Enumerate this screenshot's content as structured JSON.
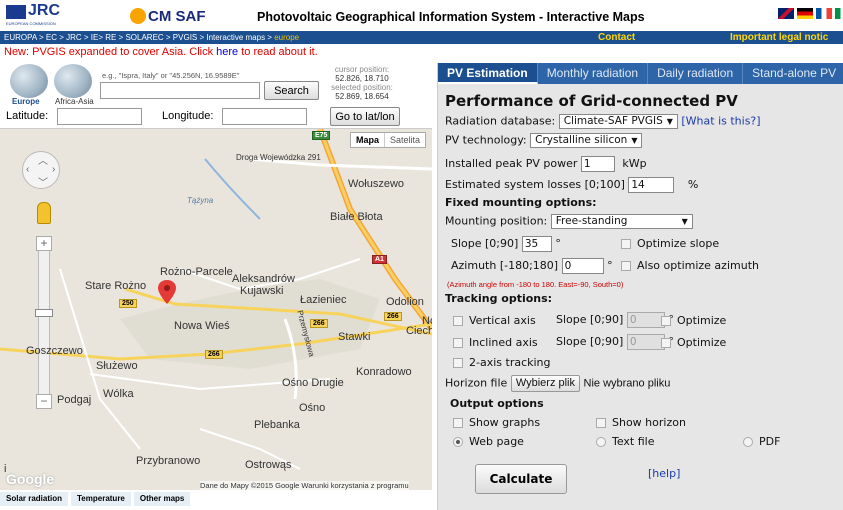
{
  "header": {
    "jrc_logo_text": "JRC",
    "jrc_logo_sub": "EUROPEAN COMMISSION",
    "cmsaf_logo_text": "CM SAF",
    "title": "Photovoltaic Geographical Information System - Interactive Maps",
    "flags": [
      "uk-flag-icon",
      "de-flag-icon",
      "fr-flag-icon",
      "it-flag-icon",
      "es-flag-icon"
    ]
  },
  "breadcrumb": {
    "items": [
      "EUROPA",
      "EC",
      "JRC",
      "IE",
      "RE",
      "SOLAREC",
      "PVGIS",
      "Interactive maps"
    ],
    "text": "EUROPA > EC > JRC > IE> RE > SOLAREC > PVGIS > Interactive maps > ",
    "current": "europe",
    "contact": "Contact",
    "legal": "Important legal notic"
  },
  "notice": {
    "before": "New: PVGIS expanded to cover Asia. Click ",
    "link": "here",
    "after": " to read about it."
  },
  "search": {
    "globe_europe": "Europe",
    "globe_asia": "Africa-Asia",
    "hint": "e.g., \"Ispra, Italy\" or \"45.256N, 16.9589E\"",
    "button": "Search",
    "cursor_label": "cursor position:",
    "cursor_value": "52.826, 18.710",
    "selected_label": "selected position:",
    "selected_value": "52.869, 18.654",
    "latitude_label": "Latitude:",
    "longitude_label": "Longitude:",
    "goto_button": "Go to lat/lon"
  },
  "map": {
    "type_map": "Mapa",
    "type_satellite": "Satelita",
    "labels": {
      "droga": "Droga Wojewódzka 291",
      "wol": "Wołuszewo",
      "tazyna": "Tążyna",
      "biale": "Białe Błota",
      "rozno": "Rożno-Parcele",
      "stare": "Stare Rożno",
      "aleks1": "Aleksandrów",
      "aleks2": "Kujawski",
      "lazieniec": "Łazieniec",
      "odolion": "Odolion",
      "ciechocinek": "Ciechi",
      "nowa": "Nowa Wieś",
      "stawki": "Stawki",
      "goszczewo": "Goszczewo",
      "sluzewo": "Służewo",
      "konradowo": "Konradowo",
      "osno_d": "Ośno Drugie",
      "wolka": "Wólka",
      "podgaj": "Podgaj",
      "osno": "Ośno",
      "plebanka": "Plebanka",
      "przybranowo": "Przybranowo",
      "ostrowas": "Ostrowąs",
      "przemyslowa": "Przemysłowa",
      "nc": "Nc",
      "c_left": "i"
    },
    "road_tags": {
      "e75": "E75",
      "a1": "A1",
      "r250": "250",
      "r266a": "266",
      "r266b": "266",
      "r266c": "266"
    },
    "google": "Google",
    "credit": "Dane do Mapy ©2015 Google   Warunki korzystania z programu"
  },
  "bottom_tabs": [
    "Solar radiation",
    "Temperature",
    "Other maps"
  ],
  "panel": {
    "tabs": [
      "PV Estimation",
      "Monthly radiation",
      "Daily radiation",
      "Stand-alone PV"
    ],
    "title": "Performance of Grid-connected PV",
    "radiation_db_label": "Radiation database:",
    "radiation_db_value": "Climate-SAF PVGIS",
    "what_is_this": "[What is this?]",
    "pv_tech_label": "PV technology:",
    "pv_tech_value": "Crystalline silicon",
    "peak_power_label": "Installed peak PV power",
    "peak_power_value": "1",
    "peak_power_unit": "kWp",
    "losses_label": "Estimated system losses [0;100]",
    "losses_value": "14",
    "losses_unit": "%",
    "fixed_header": "Fixed mounting options:",
    "mounting_label": "Mounting position:",
    "mounting_value": "Free-standing",
    "slope_label": "Slope [0;90]",
    "slope_value": "35",
    "deg": "°",
    "optimize_slope": "Optimize slope",
    "azimuth_label": "Azimuth [-180;180]",
    "azimuth_value": "0",
    "also_optimize_azimuth": "Also optimize azimuth",
    "azimuth_note": "(Azimuth angle from -180 to 180. East=-90, South=0)",
    "tracking_header": "Tracking options:",
    "vertical_axis": "Vertical axis",
    "inclined_axis": "Inclined axis",
    "two_axis": "2-axis tracking",
    "track_slope_label": "Slope [0;90]",
    "track_slope_value": "0",
    "optimize": "Optimize",
    "horizon_label": "Horizon file",
    "horizon_button": "Wybierz plik",
    "horizon_status": "Nie wybrano pliku",
    "output_header": "Output options",
    "show_graphs": "Show graphs",
    "show_horizon": "Show horizon",
    "web_page": "Web page",
    "text_file": "Text file",
    "pdf": "PDF",
    "calculate": "Calculate",
    "help": "[help]"
  }
}
